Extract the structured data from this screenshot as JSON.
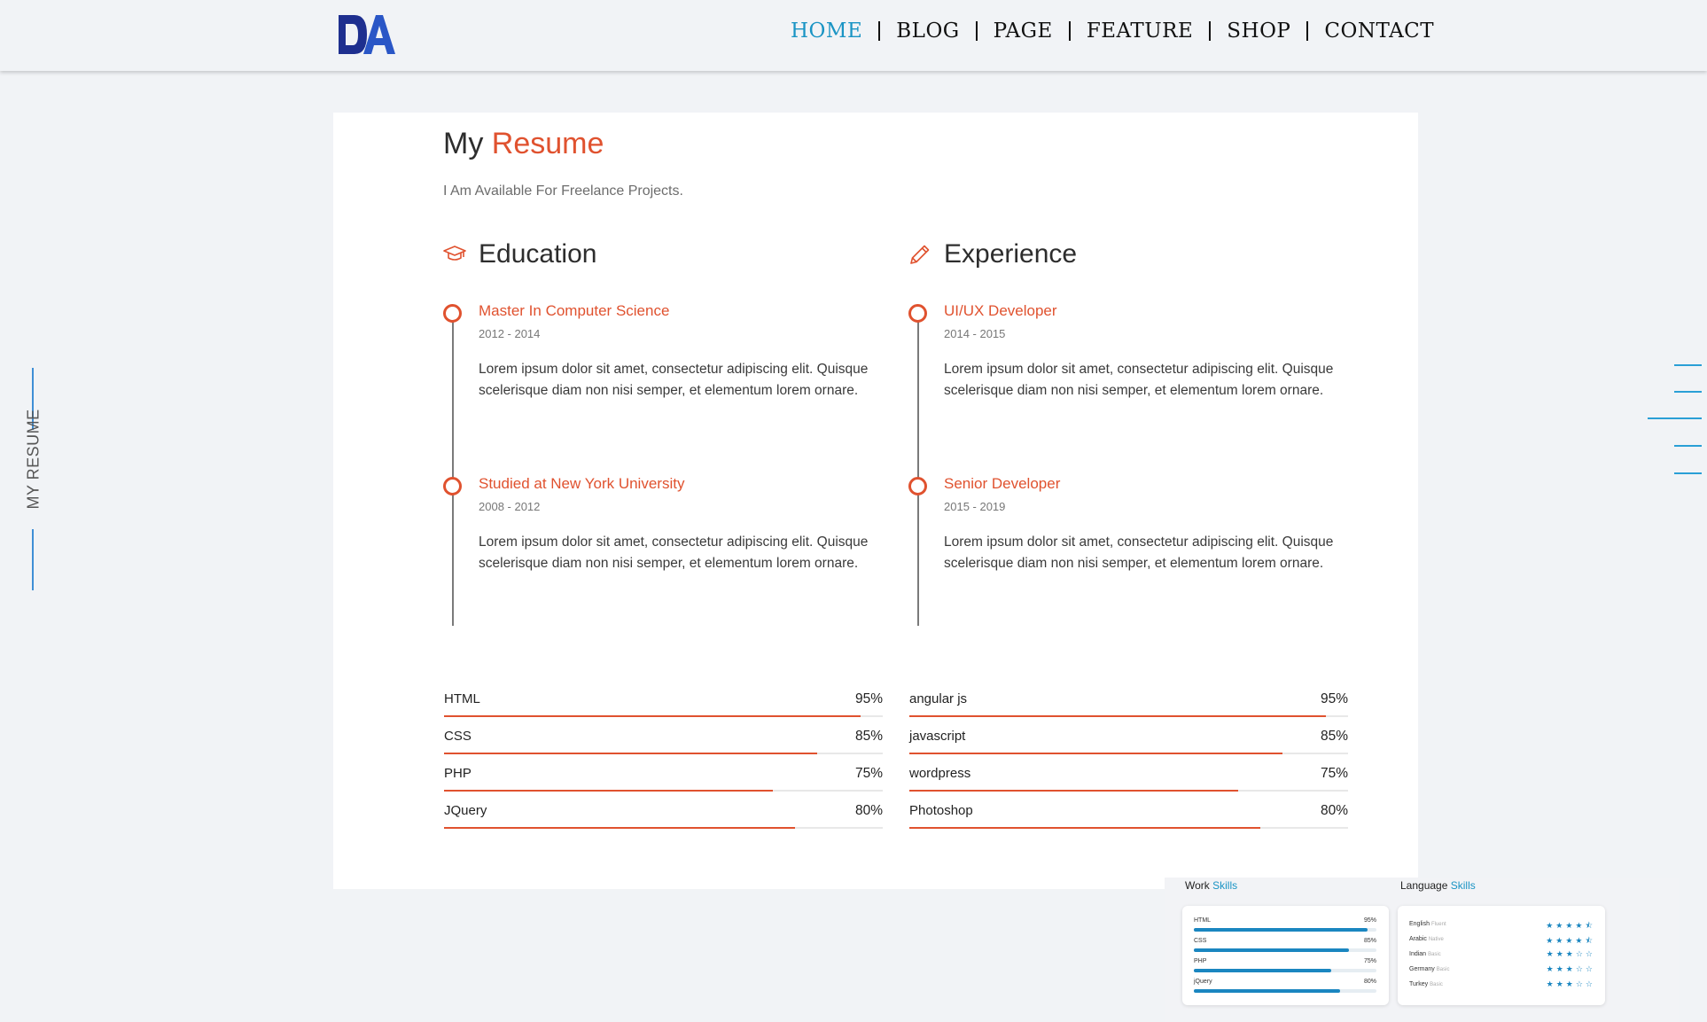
{
  "header": {
    "logo_text": "DA",
    "nav": [
      "HOME",
      "BLOG",
      "PAGE",
      "FEATURE",
      "SHOP",
      "CONTACT"
    ],
    "active": "HOME"
  },
  "sidebar": {
    "label": "MY RESUME"
  },
  "resume": {
    "title_plain": "My",
    "title_accent": "Resume",
    "subtitle": "I Am Available For Freelance Projects."
  },
  "education": {
    "heading": "Education",
    "icon": "graduation-cap-icon",
    "items": [
      {
        "title": "Master In Computer Science",
        "date": "2012 - 2014",
        "text": "Lorem ipsum dolor sit amet, consectetur adipiscing elit. Quisque scelerisque diam non nisi semper, et elementum lorem ornare."
      },
      {
        "title": "Studied at New York University",
        "date": "2008 - 2012",
        "text": "Lorem ipsum dolor sit amet, consectetur adipiscing elit. Quisque scelerisque diam non nisi semper, et elementum lorem ornare."
      }
    ]
  },
  "experience": {
    "heading": "Experience",
    "icon": "pencil-icon",
    "items": [
      {
        "title": "UI/UX Developer",
        "date": "2014 - 2015",
        "text": "Lorem ipsum dolor sit amet, consectetur adipiscing elit. Quisque scelerisque diam non nisi semper, et elementum lorem ornare."
      },
      {
        "title": "Senior Developer",
        "date": "2015 - 2019",
        "text": "Lorem ipsum dolor sit amet, consectetur adipiscing elit. Quisque scelerisque diam non nisi semper, et elementum lorem ornare."
      }
    ]
  },
  "skills_left": [
    {
      "name": "HTML",
      "pct": "95%",
      "value": 95
    },
    {
      "name": "CSS",
      "pct": "85%",
      "value": 85
    },
    {
      "name": "PHP",
      "pct": "75%",
      "value": 75
    },
    {
      "name": "JQuery",
      "pct": "80%",
      "value": 80
    }
  ],
  "skills_right": [
    {
      "name": "angular js",
      "pct": "95%",
      "value": 95
    },
    {
      "name": "javascript",
      "pct": "85%",
      "value": 85
    },
    {
      "name": "wordpress",
      "pct": "75%",
      "value": 75
    },
    {
      "name": "Photoshop",
      "pct": "80%",
      "value": 80
    }
  ],
  "preview": {
    "work_title_plain": "Work",
    "work_title_accent": "Skills",
    "language_title_plain": "Language",
    "language_title_accent": "Skills",
    "work_skills": [
      {
        "name": "HTML",
        "pct": "95%",
        "value": 95
      },
      {
        "name": "CSS",
        "pct": "85%",
        "value": 85
      },
      {
        "name": "PHP",
        "pct": "75%",
        "value": 75
      },
      {
        "name": "jQuery",
        "pct": "80%",
        "value": 80
      }
    ],
    "languages": [
      {
        "name": "English",
        "level": "Fluent",
        "stars": "★★★★⯪"
      },
      {
        "name": "Arabic",
        "level": "Native",
        "stars": "★★★★⯪"
      },
      {
        "name": "Indian",
        "level": "Basic",
        "stars": "★★★☆☆"
      },
      {
        "name": "Germany",
        "level": "Basic",
        "stars": "★★★☆☆"
      },
      {
        "name": "Turkey",
        "level": "Basic",
        "stars": "★★★☆☆"
      }
    ]
  },
  "colors": {
    "accent": "#e0522f",
    "nav_active": "#1a94c4",
    "side_blue": "#3f8fd6",
    "bar_blue": "#1a86c0"
  }
}
